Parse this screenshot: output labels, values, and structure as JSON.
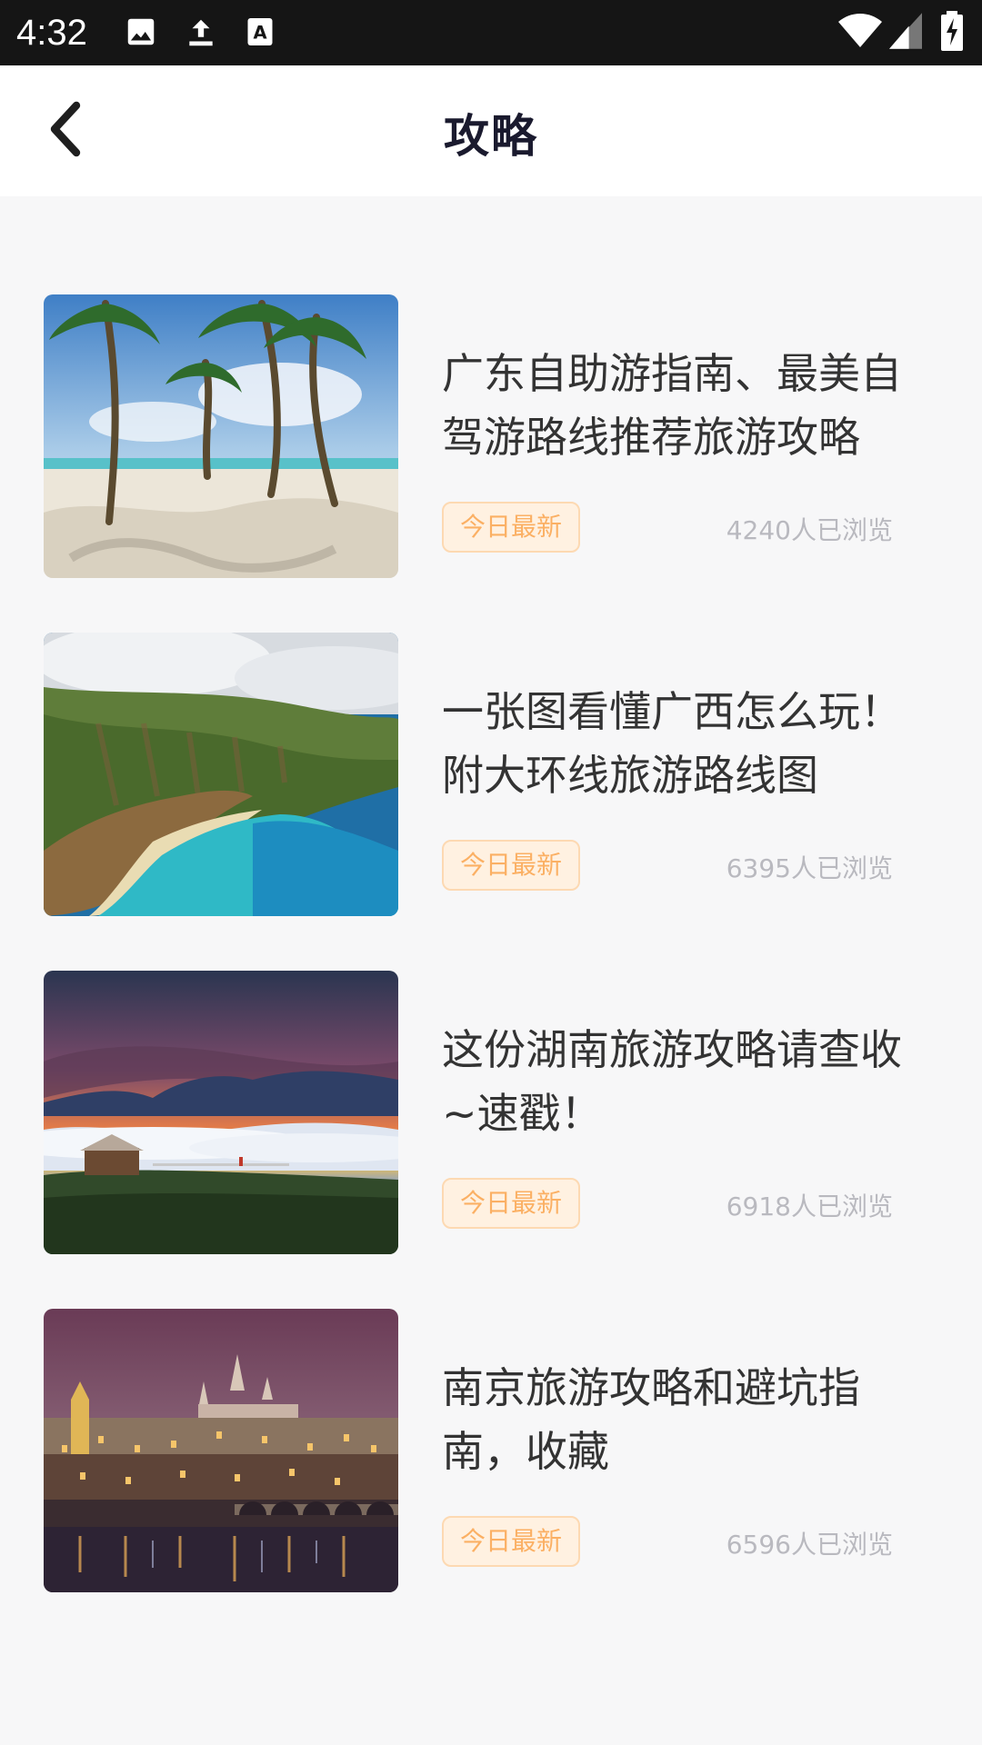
{
  "status_bar": {
    "time": "4:32",
    "icons": [
      "image-icon",
      "upload-icon",
      "font-icon",
      "wifi-icon",
      "signal-icon",
      "battery-charging-icon"
    ]
  },
  "header": {
    "back_icon": "chevron-left-icon",
    "title": "攻略"
  },
  "articles": [
    {
      "title": "广东自助游指南、最美自驾游路线推荐旅游攻略",
      "badge": "今日最新",
      "views": "4240人已浏览",
      "image": "palm-beach"
    },
    {
      "title": "一张图看懂广西怎么玩！附大环线旅游路线图",
      "badge": "今日最新",
      "views": "6395人已浏览",
      "image": "coastal-cliffs"
    },
    {
      "title": "这份湖南旅游攻略请查收~速戳！",
      "badge": "今日最新",
      "views": "6918人已浏览",
      "image": "mountain-sunset"
    },
    {
      "title": "南京旅游攻略和避坑指南，收藏",
      "badge": "今日最新",
      "views": "6596人已浏览",
      "image": "castle-night"
    }
  ],
  "colors": {
    "status_bar_bg": "#151515",
    "page_bg": "#f7f7f8",
    "badge_text": "#fbb064",
    "badge_bg": "#fff1e1",
    "views_text": "#b9b9bf"
  }
}
